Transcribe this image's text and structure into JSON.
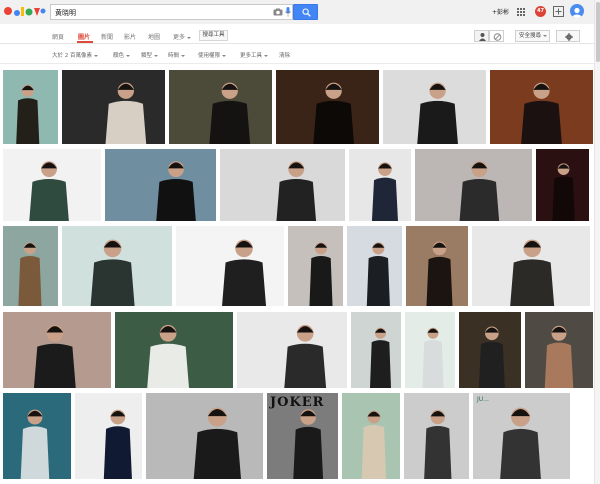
{
  "header": {
    "search_query": "黄晓明",
    "user_name": "+彭彬",
    "notification_count": "47",
    "accent_color": "#4285f4",
    "logo_colors": [
      "#4285f4",
      "#ea4335",
      "#fbbc05",
      "#34a853"
    ]
  },
  "tabs": [
    {
      "label": "網頁",
      "active": false
    },
    {
      "label": "圖片",
      "active": true
    },
    {
      "label": "新聞",
      "active": false
    },
    {
      "label": "影片",
      "active": false
    },
    {
      "label": "地圖",
      "active": false
    },
    {
      "label": "更多",
      "active": false
    }
  ],
  "tools": {
    "search_tools": "搜尋工具",
    "safesearch": "安全搜尋"
  },
  "filters": [
    {
      "label": "大於 2 百萬像素",
      "dropdown": true
    },
    {
      "label": "顏色",
      "dropdown": true
    },
    {
      "label": "類型",
      "dropdown": true
    },
    {
      "label": "時間",
      "dropdown": true
    },
    {
      "label": "使用權限",
      "dropdown": true
    },
    {
      "label": "更多工具",
      "dropdown": true
    },
    {
      "label": "清除",
      "dropdown": false
    }
  ],
  "thumbnail_texts": {
    "poster_title": "JOKER",
    "magazine_label": "JU..."
  },
  "image_results": [
    {
      "bg": "#8fb8b0",
      "fg": "#222018"
    },
    {
      "bg": "#2a2a2a",
      "fg": "#d7cfc4"
    },
    {
      "bg": "#4c4a38",
      "fg": "#151311"
    },
    {
      "bg": "#3a2418",
      "fg": "#0d0906"
    },
    {
      "bg": "#dcdcdc",
      "fg": "#1a1a1a"
    },
    {
      "bg": "#7a3b1e",
      "fg": "#1a1110"
    },
    {
      "bg": "#f2f2f2",
      "fg": "#2f4a3e"
    },
    {
      "bg": "#6f8fa0",
      "fg": "#111"
    },
    {
      "bg": "#d9d9d9",
      "fg": "#222"
    },
    {
      "bg": "#e7e7e7",
      "fg": "#1f2638"
    },
    {
      "bg": "#bcb7b5",
      "fg": "#2b2b2b"
    },
    {
      "bg": "#2a1010",
      "fg": "#120808"
    },
    {
      "bg": "#8da6a0",
      "fg": "#7a5a3a"
    },
    {
      "bg": "#cfe0dd",
      "fg": "#2a3430"
    },
    {
      "bg": "#f4f4f4",
      "fg": "#1f1f1f"
    },
    {
      "bg": "#c6c0bd",
      "fg": "#191919"
    },
    {
      "bg": "#d5dbe0",
      "fg": "#1b1e22"
    },
    {
      "bg": "#9a7b64",
      "fg": "#1c1410"
    },
    {
      "bg": "#e8e8e8",
      "fg": "#2c2a26"
    },
    {
      "bg": "#b59b8f",
      "fg": "#1b1b1b"
    },
    {
      "bg": "#3c5c46",
      "fg": "#e9ece6"
    },
    {
      "bg": "#e9e9e9",
      "fg": "#2a2a2a"
    },
    {
      "bg": "#cfd5d3",
      "fg": "#1e1e1e"
    },
    {
      "bg": "#e3ece7",
      "fg": "#d8dcdc"
    },
    {
      "bg": "#3a3024",
      "fg": "#202020"
    },
    {
      "bg": "#4f4a44",
      "fg": "#a8795c"
    },
    {
      "bg": "#2a6a7a",
      "fg": "#cfd8da"
    },
    {
      "bg": "#eeeeee",
      "fg": "#101a33"
    },
    {
      "bg": "#b9b9b9",
      "fg": "#1a1a1a"
    },
    {
      "bg": "#7c7c7c",
      "fg": "#1a1a1a"
    },
    {
      "bg": "#a9c4b0",
      "fg": "#d7c9b1"
    }
  ]
}
